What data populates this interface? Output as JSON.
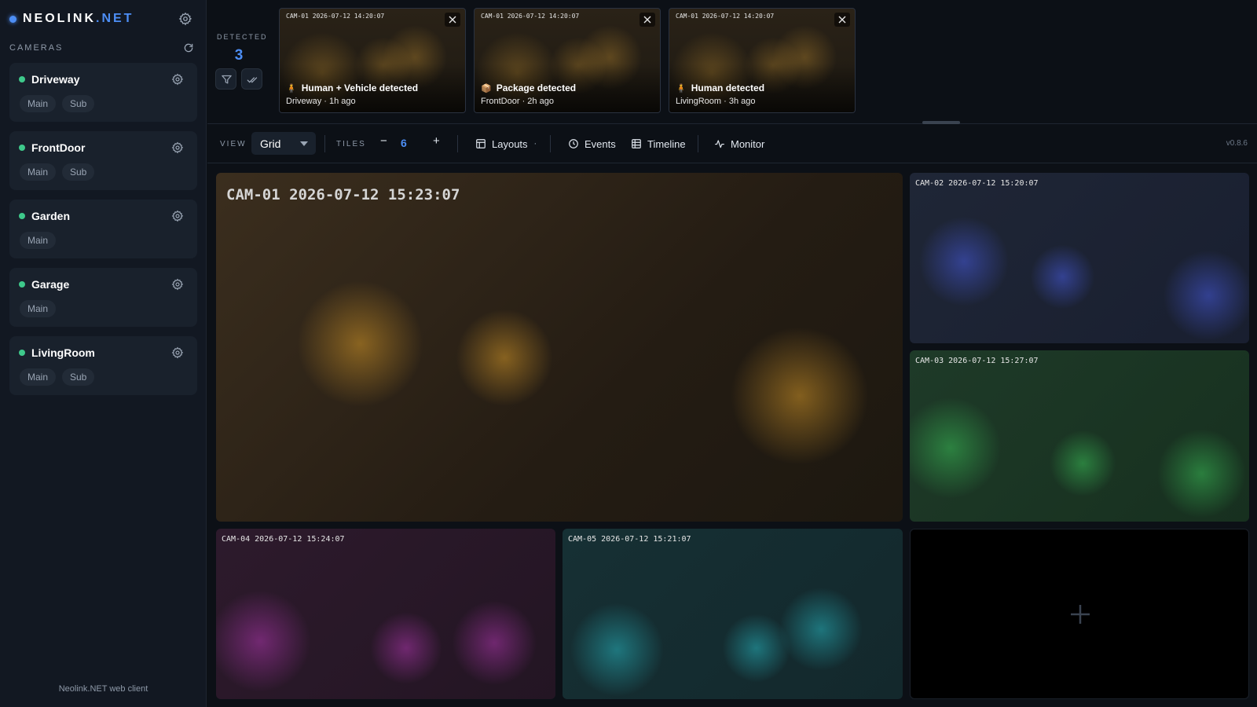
{
  "brand": {
    "name": "NEOLINK",
    "tld": ".NET"
  },
  "sidebar": {
    "section_title": "CAMERAS",
    "cameras": [
      {
        "name": "Driveway",
        "status": "online",
        "streams": [
          "Main",
          "Sub"
        ]
      },
      {
        "name": "FrontDoor",
        "status": "online",
        "streams": [
          "Main",
          "Sub"
        ]
      },
      {
        "name": "Garden",
        "status": "online",
        "streams": [
          "Main"
        ]
      },
      {
        "name": "Garage",
        "status": "online",
        "streams": [
          "Main"
        ]
      },
      {
        "name": "LivingRoom",
        "status": "online",
        "streams": [
          "Main",
          "Sub"
        ]
      }
    ],
    "footer": "Neolink.NET web client"
  },
  "detections": {
    "label": "DETECTED",
    "count": "3",
    "items": [
      {
        "timestamp": "CAM-01  2026-07-12 14:20:07",
        "icon": "person-icon",
        "title": "Human + Vehicle detected",
        "subtitle": "Driveway · 1h ago"
      },
      {
        "timestamp": "CAM-01  2026-07-12 14:20:07",
        "icon": "package-icon",
        "title": "Package detected",
        "subtitle": "FrontDoor · 2h ago"
      },
      {
        "timestamp": "CAM-01  2026-07-12 14:20:07",
        "icon": "person-icon",
        "title": "Human detected",
        "subtitle": "LivingRoom · 3h ago"
      }
    ]
  },
  "toolbar": {
    "view_label": "VIEW",
    "view_value": "Grid",
    "tiles_label": "TILES",
    "tiles_minus": "−",
    "tiles_count": "6",
    "tiles_plus": "+",
    "layouts": "Layouts",
    "layouts_suffix": "·",
    "events": "Events",
    "timeline": "Timeline",
    "monitor": "Monitor",
    "version": "v0.8.6"
  },
  "grid": {
    "tiles": [
      {
        "overlay": "CAM-01  2026-07-12 15:23:07"
      },
      {
        "overlay": "CAM-02  2026-07-12 15:20:07"
      },
      {
        "overlay": "CAM-03  2026-07-12 15:27:07"
      },
      {
        "overlay": "CAM-04  2026-07-12 15:24:07"
      },
      {
        "overlay": "CAM-05  2026-07-12 15:21:07"
      }
    ],
    "empty_tile_icon": "plus-icon"
  },
  "colors": {
    "accent": "#4d8ef5",
    "online": "#3ec98b",
    "background": "#0c1016",
    "sidebar": "#121822"
  }
}
